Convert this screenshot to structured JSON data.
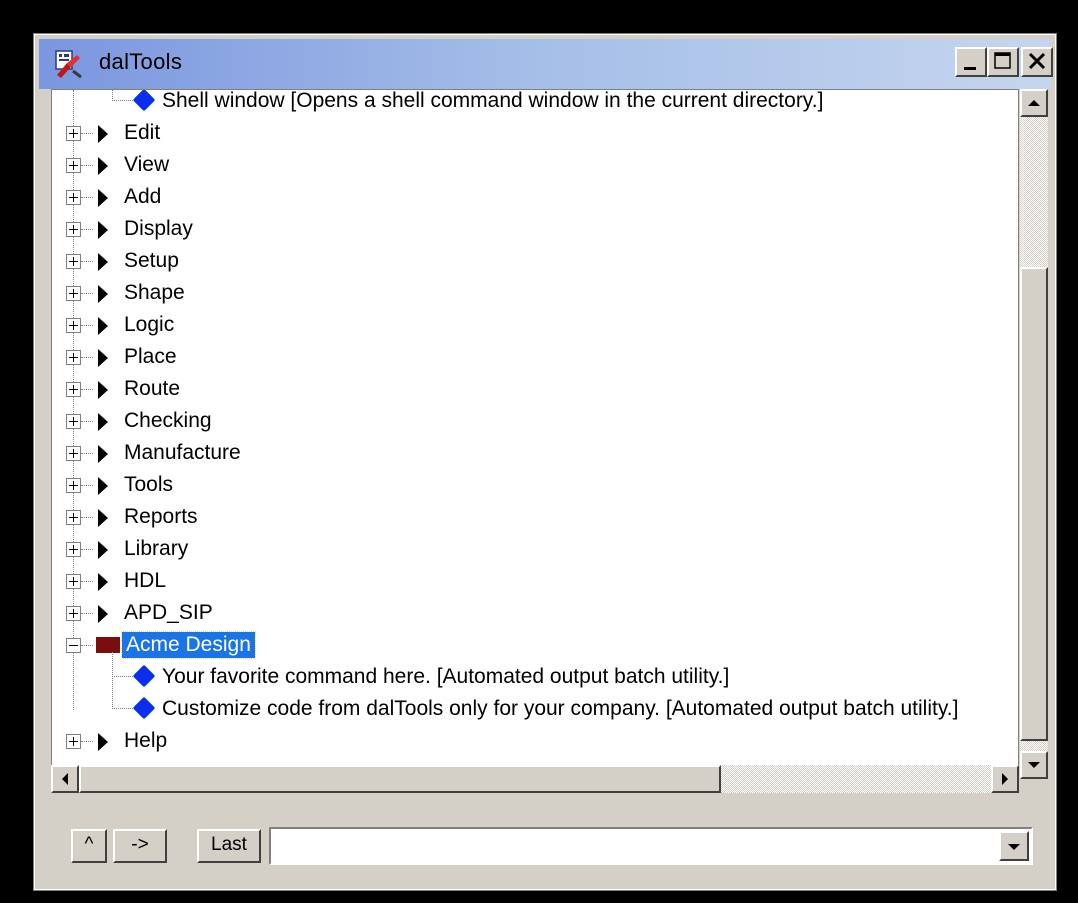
{
  "window": {
    "title": "dalTools"
  },
  "tree": {
    "top_child": {
      "label": "Shell window [Opens a shell command window in the current directory.]"
    },
    "menus": [
      {
        "label": "Edit"
      },
      {
        "label": "View"
      },
      {
        "label": "Add"
      },
      {
        "label": "Display"
      },
      {
        "label": "Setup"
      },
      {
        "label": "Shape"
      },
      {
        "label": "Logic"
      },
      {
        "label": "Place"
      },
      {
        "label": "Route"
      },
      {
        "label": "Checking"
      },
      {
        "label": "Manufacture"
      },
      {
        "label": "Tools"
      },
      {
        "label": "Reports"
      },
      {
        "label": "Library"
      },
      {
        "label": "HDL"
      },
      {
        "label": "APD_SIP"
      }
    ],
    "selected": {
      "label": "Acme Design",
      "children": [
        {
          "label": "Your favorite command here. [Automated output batch utility.]"
        },
        {
          "label": "Customize code from dalTools only for your company. [Automated output batch utility.]"
        }
      ]
    },
    "last": {
      "label": "Help"
    }
  },
  "toolbar": {
    "up_label": "^",
    "forward_label": "->",
    "last_label": "Last",
    "command_value": ""
  },
  "icons": {
    "app": "daltools-app-icon",
    "menu_node": "black-triangle-icon",
    "command_node": "blue-diamond-icon",
    "custom_node": "dark-red-square-icon"
  },
  "colors": {
    "title_gradient_start": "#7a96df",
    "title_gradient_end": "#c5d5ee",
    "selection": "#1a74e6",
    "command_diamond": "#0a2ff0",
    "custom_square": "#7a0d0d"
  }
}
